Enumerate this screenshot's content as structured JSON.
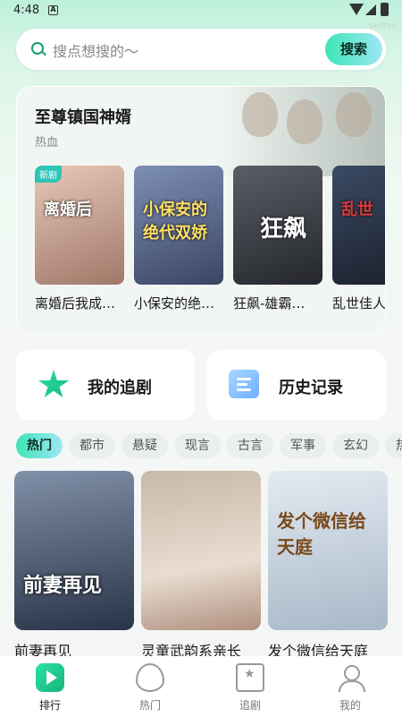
{
  "status": {
    "time": "4:48",
    "code": "9e0f90"
  },
  "search": {
    "placeholder": "搜点想搜的～",
    "button": "搜索"
  },
  "featured": {
    "title": "至尊镇国神婿",
    "tag": "热血",
    "items": [
      {
        "name": "离婚后我成…",
        "badge": "新剧",
        "art": "离婚后",
        "color": "#c99a86"
      },
      {
        "name": "小保安的绝…",
        "badge": "",
        "art": "小保安的绝代双娇",
        "color": "#5d6b8a"
      },
      {
        "name": "狂飙-雄霸…",
        "badge": "",
        "art": "狂飙",
        "color": "#3a3d44"
      },
      {
        "name": "乱世佳人",
        "badge": "",
        "art": "乱世",
        "color": "#1f2a3a"
      }
    ]
  },
  "quick": {
    "follow": "我的追剧",
    "history": "历史记录"
  },
  "categories": [
    "热门",
    "都市",
    "悬疑",
    "现言",
    "古言",
    "军事",
    "玄幻",
    "热"
  ],
  "grid": [
    {
      "name": "前妻再见",
      "art": "前妻再见",
      "color": "#40506a"
    },
    {
      "name": "灵童武韵系亲长",
      "art": "",
      "color": "#b9a090"
    },
    {
      "name": "发个微信给天庭",
      "art": "发个微信给天庭",
      "color": "#c8d4e0"
    }
  ],
  "tabs": [
    "排行",
    "热门",
    "追剧",
    "我的"
  ]
}
